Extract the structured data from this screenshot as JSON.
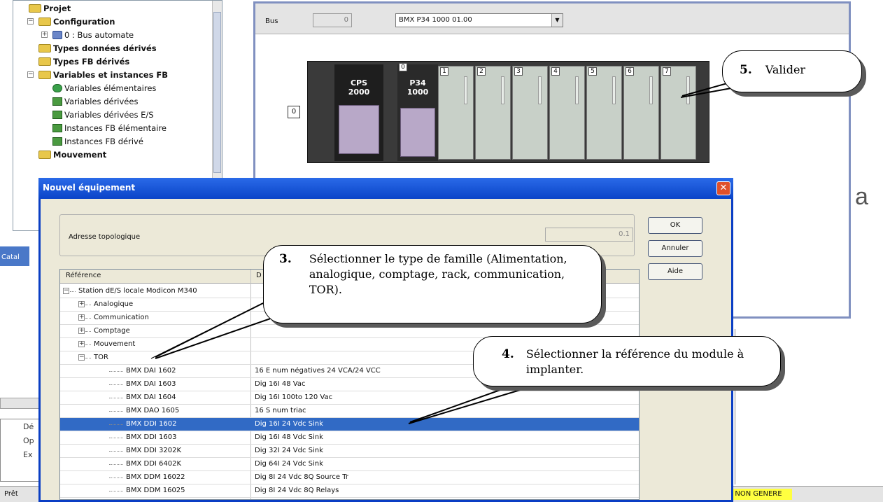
{
  "tree": {
    "items": [
      {
        "label": "Projet",
        "bold": true
      },
      {
        "label": "Configuration",
        "bold": true
      },
      {
        "label": "0 : Bus automate",
        "bold": false
      },
      {
        "label": "Types données dérivés",
        "bold": true
      },
      {
        "label": "Types FB dérivés",
        "bold": true
      },
      {
        "label": "Variables et instances FB",
        "bold": true
      },
      {
        "label": "Variables élémentaires",
        "bold": false
      },
      {
        "label": "Variables dérivées",
        "bold": false
      },
      {
        "label": "Variables dérivées E/S",
        "bold": false
      },
      {
        "label": "Instances FB élémentaire",
        "bold": false
      },
      {
        "label": "Instances FB dérivé",
        "bold": false
      },
      {
        "label": "Mouvement",
        "bold": true
      }
    ]
  },
  "rack_editor": {
    "bus_label": "Bus",
    "bus_number": "0",
    "bus_select": "BMX P34 1000  01.00",
    "rack_address": "0",
    "power_supply": {
      "line1": "CPS",
      "line2": "2000"
    },
    "cpu": {
      "line1": "P34",
      "line2": "1000"
    },
    "slots": [
      "0",
      "1",
      "2",
      "3",
      "4",
      "5",
      "6",
      "7"
    ]
  },
  "background_text": "a",
  "left_tab": "Catal",
  "messages": [
    "Dé",
    "Op",
    "Ex"
  ],
  "status": {
    "ready": "Prêt",
    "generation": "NON GENERE"
  },
  "dialog": {
    "title": "Nouvel équipement",
    "close": "✕",
    "topo_label": "Adresse topologique",
    "topo_value": "0.1",
    "buttons": {
      "ok": "OK",
      "cancel": "Annuler",
      "help": "Aide"
    },
    "table": {
      "headers": [
        "Référence",
        "D"
      ],
      "rows": [
        {
          "ref": "Station dE/S locale Modicon M340",
          "desc": "",
          "level": 0,
          "expander": "−"
        },
        {
          "ref": "Analogique",
          "desc": "",
          "level": 1,
          "expander": "+"
        },
        {
          "ref": "Communication",
          "desc": "",
          "level": 1,
          "expander": "+"
        },
        {
          "ref": "Comptage",
          "desc": "",
          "level": 1,
          "expander": "+"
        },
        {
          "ref": "Mouvement",
          "desc": "",
          "level": 1,
          "expander": "+"
        },
        {
          "ref": "TOR",
          "desc": "",
          "level": 1,
          "expander": "−"
        },
        {
          "ref": "BMX DAI 1602",
          "desc": "16 E num négatives 24 VCA/24 VCC",
          "level": 2,
          "expander": ""
        },
        {
          "ref": "BMX DAI 1603",
          "desc": "Dig 16I 48 Vac",
          "level": 2,
          "expander": ""
        },
        {
          "ref": "BMX DAI 1604",
          "desc": "Dig 16I 100to 120 Vac",
          "level": 2,
          "expander": ""
        },
        {
          "ref": "BMX DAO 1605",
          "desc": "16 S num triac",
          "level": 2,
          "expander": ""
        },
        {
          "ref": "BMX DDI 1602",
          "desc": "Dig 16I 24 Vdc Sink",
          "level": 2,
          "expander": "",
          "selected": true
        },
        {
          "ref": "BMX DDI 1603",
          "desc": "Dig 16I 48 Vdc Sink",
          "level": 2,
          "expander": ""
        },
        {
          "ref": "BMX DDI 3202K",
          "desc": "Dig 32I 24 Vdc Sink",
          "level": 2,
          "expander": ""
        },
        {
          "ref": "BMX DDI 6402K",
          "desc": "Dig 64I 24 Vdc Sink",
          "level": 2,
          "expander": ""
        },
        {
          "ref": "BMX DDM 16022",
          "desc": "Dig 8I 24 Vdc 8Q Source Tr",
          "level": 2,
          "expander": ""
        },
        {
          "ref": "BMX DDM 16025",
          "desc": "Dig 8I 24 Vdc 8Q Relays",
          "level": 2,
          "expander": ""
        }
      ]
    }
  },
  "callouts": {
    "step3": {
      "num": "3.",
      "text": "Sélectionner le type de famille (Alimentation, analogique, comptage, rack, communication, TOR)."
    },
    "step4": {
      "num": "4.",
      "text": "Sélectionner la référence du module à implanter."
    },
    "step5": {
      "num": "5.",
      "text": "Valider"
    }
  }
}
